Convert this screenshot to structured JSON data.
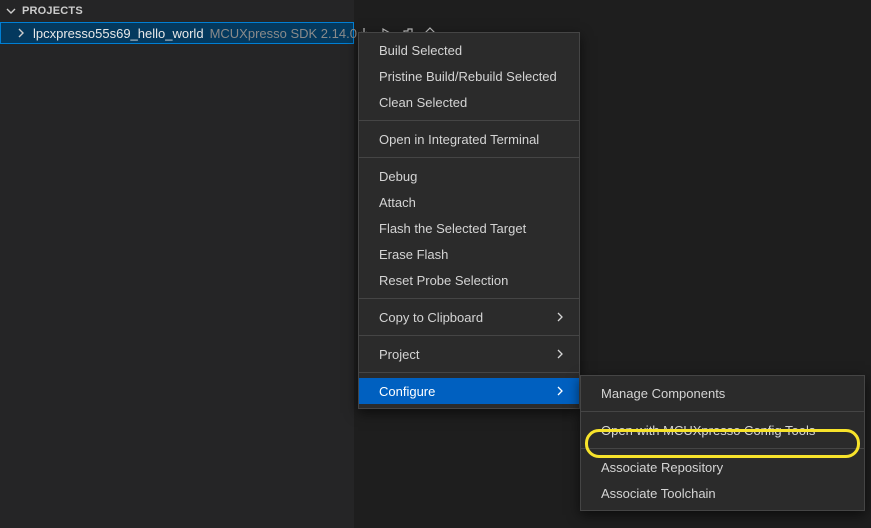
{
  "panel": {
    "title": "PROJECTS"
  },
  "project": {
    "name": "lpcxpresso55s69_hello_world",
    "meta": "MCUXpresso SDK 2.14.0"
  },
  "toolbar_icons": {
    "download": "download-icon",
    "run": "run-icon",
    "extension": "extension-icon",
    "diamond": "diamond-icon"
  },
  "menu": {
    "group1": [
      "Build Selected",
      "Pristine Build/Rebuild Selected",
      "Clean Selected"
    ],
    "group2": [
      "Open in Integrated Terminal"
    ],
    "group3": [
      "Debug",
      "Attach",
      "Flash the Selected Target",
      "Erase Flash",
      "Reset Probe Selection"
    ],
    "group4": [
      {
        "label": "Copy to Clipboard",
        "submenu": true
      }
    ],
    "group5": [
      {
        "label": "Project",
        "submenu": true
      }
    ],
    "group6": [
      {
        "label": "Configure",
        "submenu": true,
        "active": true
      }
    ]
  },
  "submenu": {
    "items": [
      {
        "label": "Manage Components"
      },
      {
        "sep": true
      },
      {
        "label": "Open with MCUXpresso Config Tools",
        "highlight": true
      },
      {
        "sep": true
      },
      {
        "label": "Associate Repository"
      },
      {
        "label": "Associate Toolchain"
      }
    ]
  }
}
